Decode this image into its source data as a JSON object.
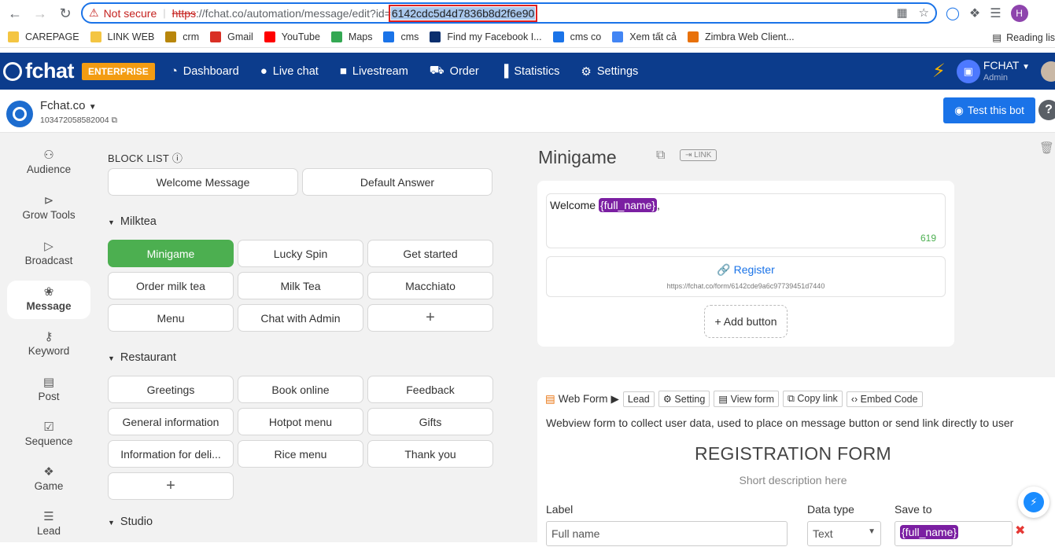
{
  "browser": {
    "security_label": "Not secure",
    "url_scheme": "https",
    "url_path": "://fchat.co/automation/message/edit?id=",
    "url_id": "6142cdc5d4d7836b8d2f6e90",
    "profile_initial": "H"
  },
  "bookmarks": [
    {
      "label": "CAREPAGE",
      "color": "#f4c542"
    },
    {
      "label": "LINK WEB",
      "color": "#f4c542"
    },
    {
      "label": "crm",
      "color": "#b8860b"
    },
    {
      "label": "Gmail",
      "color": "#d93025"
    },
    {
      "label": "YouTube",
      "color": "#ff0000"
    },
    {
      "label": "Maps",
      "color": "#34a853"
    },
    {
      "label": "cms",
      "color": "#1a73e8"
    },
    {
      "label": "Find my Facebook I...",
      "color": "#0b2f6e"
    },
    {
      "label": "cms co",
      "color": "#1a73e8"
    },
    {
      "label": "Xem tất cả",
      "color": "#4285f4"
    },
    {
      "label": "Zimbra Web Client...",
      "color": "#e8710a"
    }
  ],
  "reading_list": "Reading lis",
  "app": {
    "logo": "fchat",
    "edition": "ENTERPRISE",
    "nav": [
      {
        "label": "Dashboard",
        "icon": "dashboard-icon"
      },
      {
        "label": "Live chat",
        "icon": "chat-icon"
      },
      {
        "label": "Livestream",
        "icon": "video-icon"
      },
      {
        "label": "Order",
        "icon": "cart-icon"
      },
      {
        "label": "Statistics",
        "icon": "chart-icon"
      },
      {
        "label": "Settings",
        "icon": "gear-icon"
      }
    ],
    "user_name": "FCHAT",
    "user_role": "Admin"
  },
  "page": {
    "name": "Fchat.co",
    "id": "103472058582004",
    "test_button": "Test this bot"
  },
  "sidebar": [
    {
      "label": "Audience",
      "icon": "user-icon"
    },
    {
      "label": "Grow Tools",
      "icon": "funnel-icon"
    },
    {
      "label": "Broadcast",
      "icon": "send-icon"
    },
    {
      "label": "Message",
      "icon": "message-icon"
    },
    {
      "label": "Keyword",
      "icon": "key-icon"
    },
    {
      "label": "Post",
      "icon": "post-icon"
    },
    {
      "label": "Sequence",
      "icon": "calendar-icon"
    },
    {
      "label": "Game",
      "icon": "gamepad-icon"
    },
    {
      "label": "Lead",
      "icon": "list-icon"
    }
  ],
  "block_list": {
    "title": "BLOCK LIST",
    "default_blocks": [
      "Welcome Message",
      "Default Answer"
    ],
    "groups": [
      {
        "name": "Milktea",
        "blocks": [
          "Minigame",
          "Lucky Spin",
          "Get started",
          "Order milk tea",
          "Milk Tea",
          "Macchiato",
          "Menu",
          "Chat with Admin"
        ]
      },
      {
        "name": "Restaurant",
        "blocks": [
          "Greetings",
          "Book online",
          "Feedback",
          "General information",
          "Hotpot menu",
          "Gifts",
          "Information for deli...",
          "Rice menu",
          "Thank you"
        ]
      },
      {
        "name": "Studio",
        "blocks": []
      }
    ],
    "active_block": "Minigame"
  },
  "editor": {
    "title": "Minigame",
    "link_label": "LINK",
    "message_prefix": "Welcome ",
    "message_var": "{full_name}",
    "message_suffix": ",",
    "char_count": "619",
    "button_label": "Register",
    "button_url": "https://fchat.co/form/6142cde9a6c97739451d7440",
    "add_button": "+ Add button"
  },
  "webform": {
    "title": "Web Form",
    "tabs": [
      "Lead",
      "Setting",
      "View form",
      "Copy link",
      "Embed Code"
    ],
    "description": "Webview form to collect user data, used to place on message button or send link directly to user",
    "heading": "REGISTRATION FORM",
    "subheading": "Short description here",
    "col_label": "Label",
    "col_type": "Data type",
    "col_save": "Save to",
    "row_label": "Full name",
    "row_type": "Text",
    "row_save": "{full_name}"
  }
}
